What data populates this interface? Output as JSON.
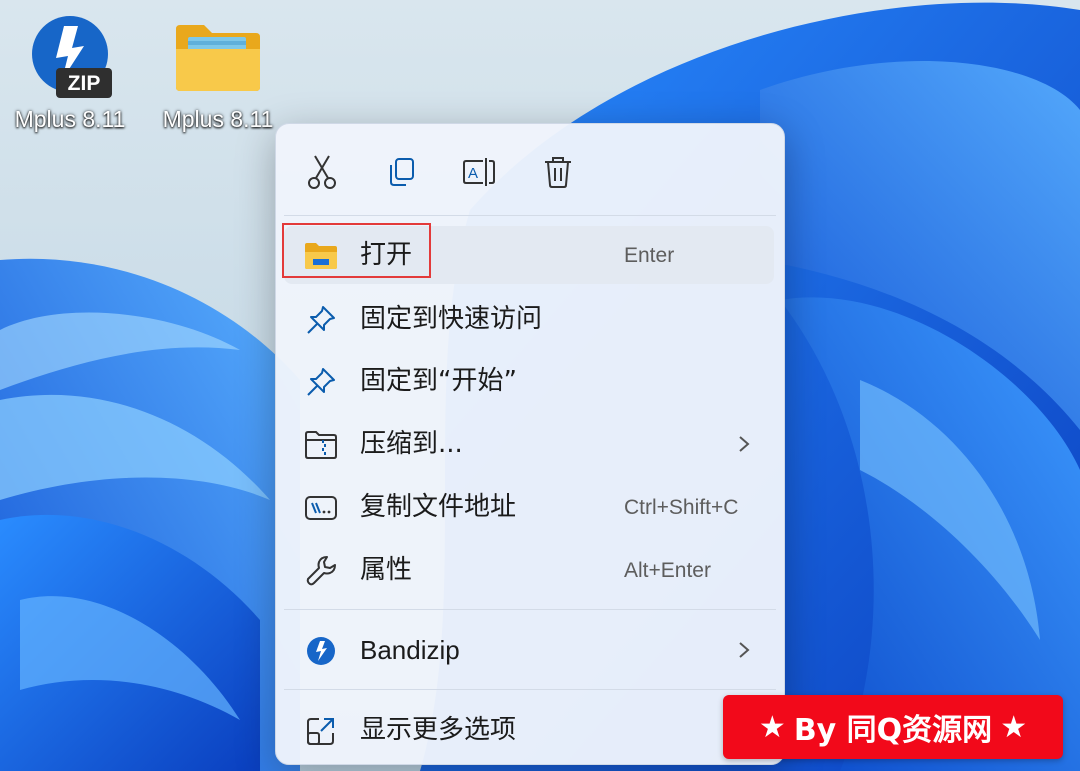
{
  "desktop": {
    "icons": [
      {
        "label": "Mplus 8.11",
        "badge": "ZIP",
        "icon": "bandizip-zip-icon"
      },
      {
        "label": "Mplus 8.11",
        "icon": "folder-icon"
      }
    ]
  },
  "context_menu": {
    "toolbar": [
      {
        "name": "cut",
        "icon": "scissors-icon"
      },
      {
        "name": "copy",
        "icon": "copy-icon"
      },
      {
        "name": "rename",
        "icon": "rename-icon"
      },
      {
        "name": "delete",
        "icon": "trash-icon"
      }
    ],
    "items": [
      {
        "label": "打开",
        "shortcut": "Enter",
        "icon": "folder-open-icon"
      },
      {
        "label": "固定到快速访问",
        "shortcut": "",
        "icon": "pin-icon"
      },
      {
        "label": "固定到“开始”",
        "shortcut": "",
        "icon": "pin-icon"
      },
      {
        "label": "压缩到...",
        "shortcut": "",
        "icon": "zip-folder-icon",
        "submenu": true
      },
      {
        "label": "复制文件地址",
        "shortcut": "Ctrl+Shift+C",
        "icon": "copy-path-icon"
      },
      {
        "label": "属性",
        "shortcut": "Alt+Enter",
        "icon": "wrench-icon"
      },
      {
        "label": "Bandizip",
        "shortcut": "",
        "icon": "bandizip-icon",
        "submenu": true
      },
      {
        "label": "显示更多选项",
        "shortcut": "",
        "icon": "show-more-icon"
      }
    ]
  },
  "watermark": {
    "star": "★",
    "text": "By 同Q资源网"
  },
  "colors": {
    "menu_bg": "#eff4fb",
    "accent_blue": "#1e6fd0",
    "highlight_red": "#e33a3a",
    "watermark_red": "#f2091a"
  }
}
